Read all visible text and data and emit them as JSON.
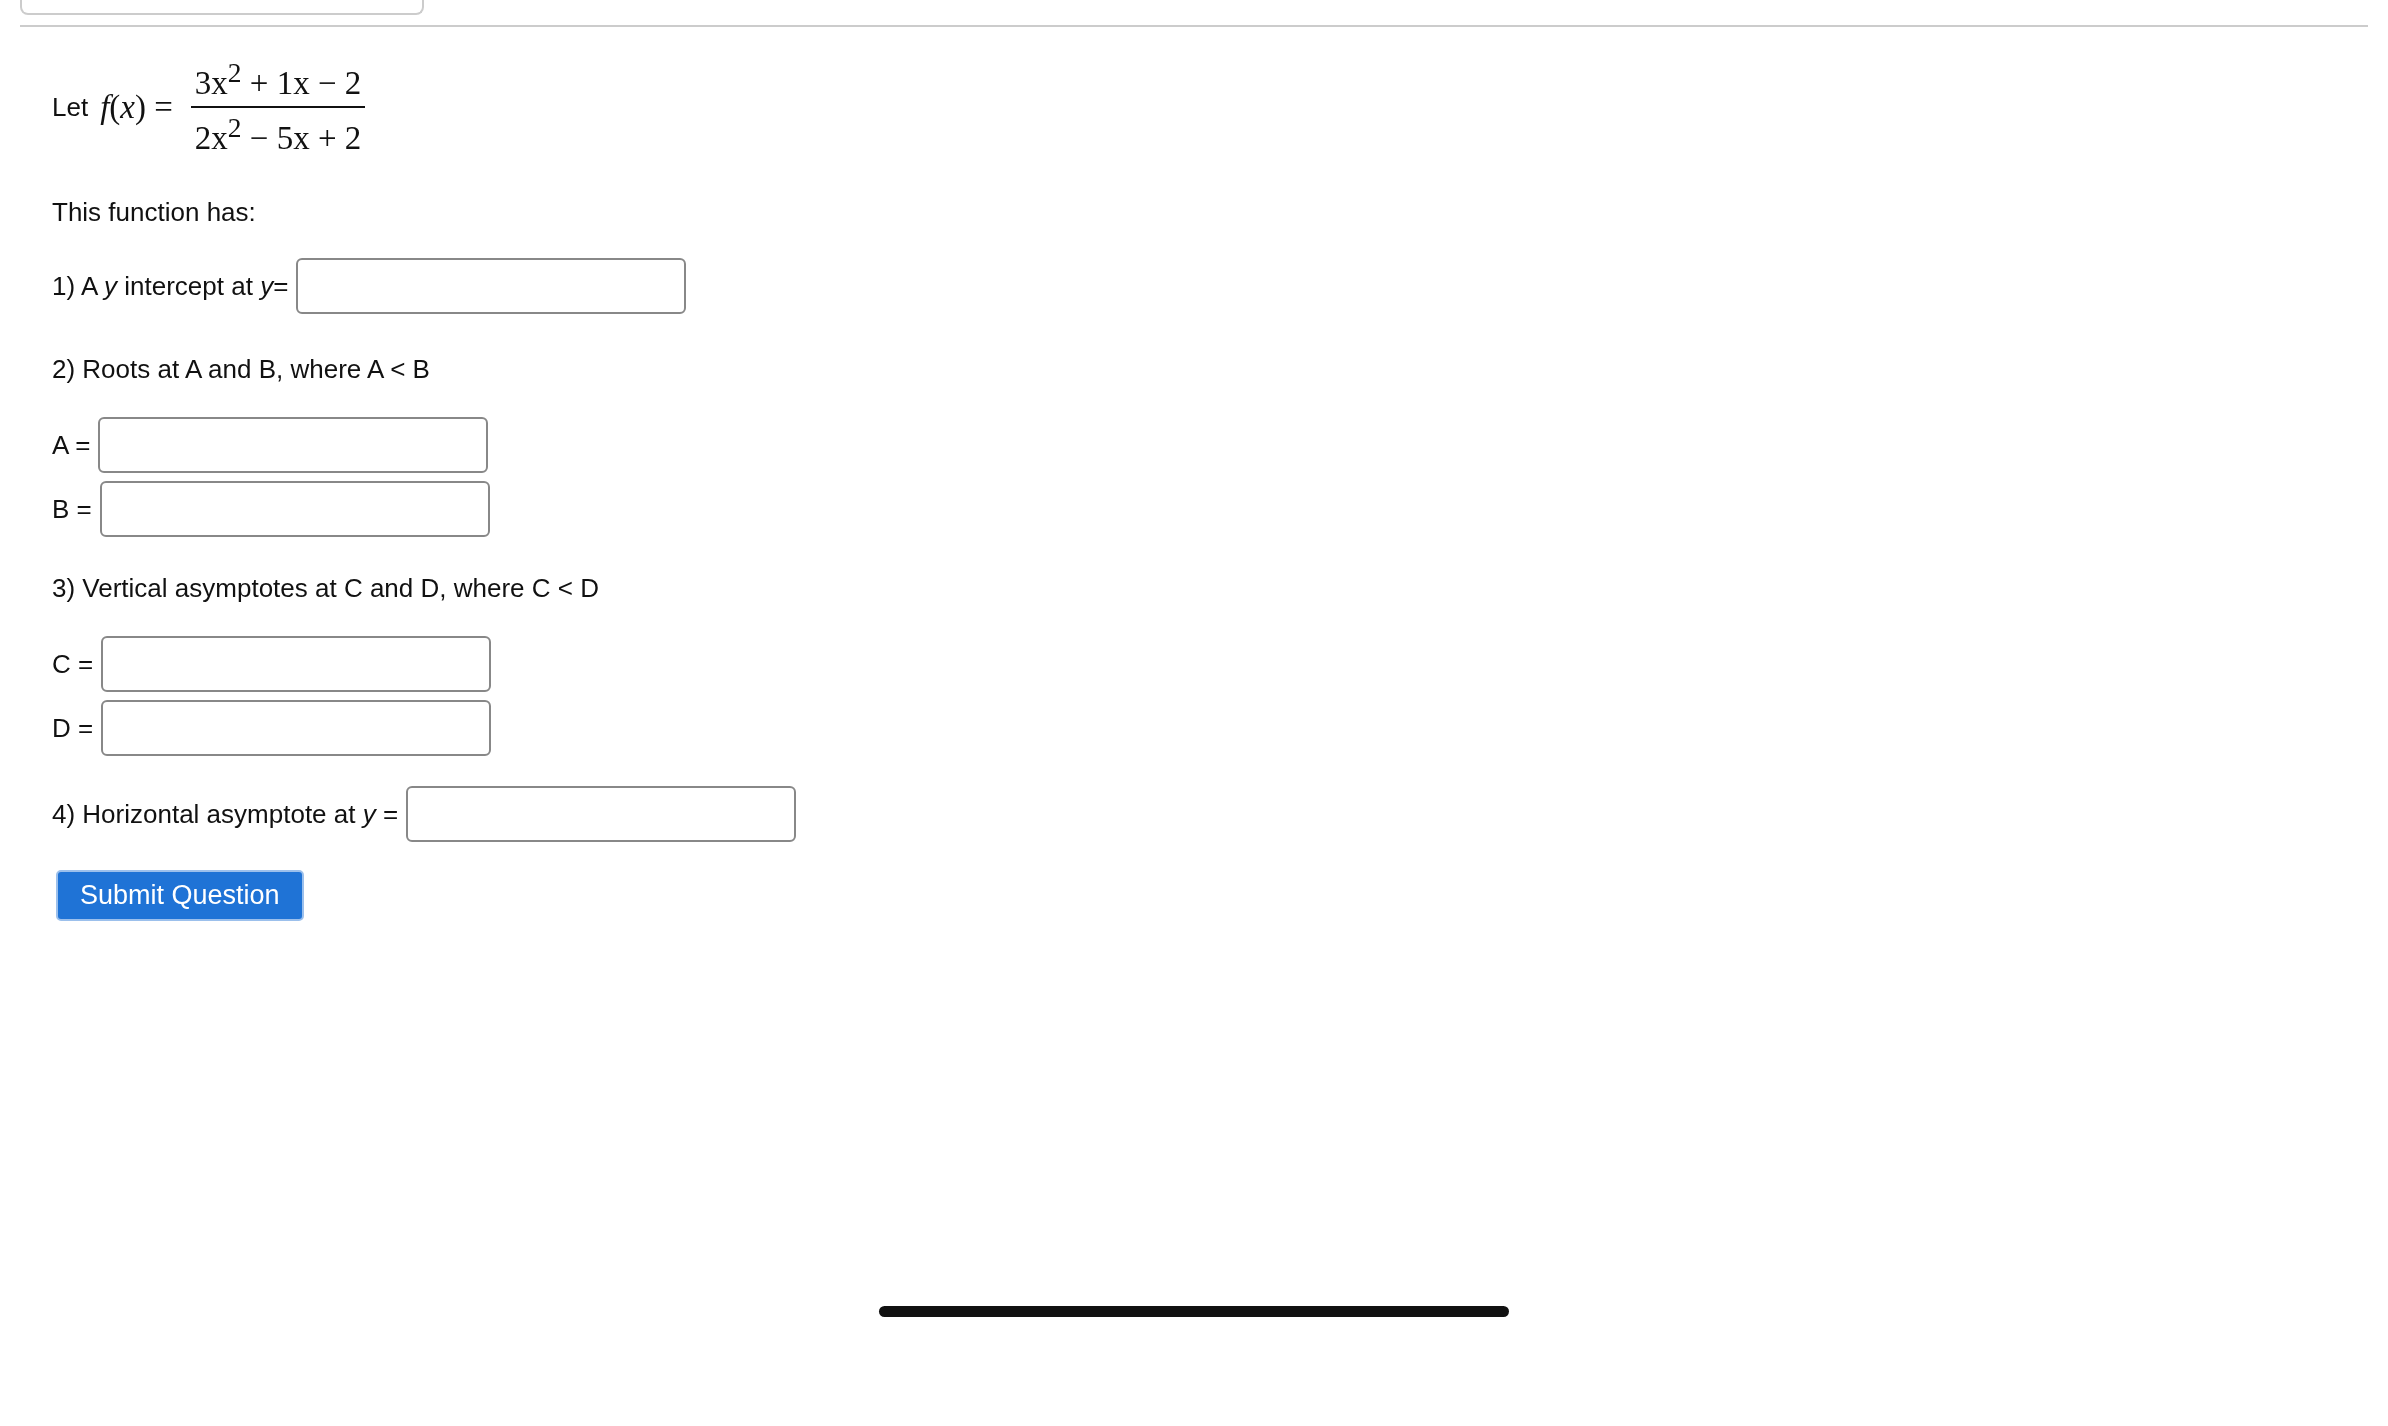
{
  "formula": {
    "prefix": "Let",
    "lhs": "*f*(*x*) =",
    "numerator": "3x$^{2}$ + 1x − 2",
    "denominator": "2x$^{2}$ − 5x + 2"
  },
  "blocks": [
    {
      "kind": "text",
      "text": "This function has:"
    },
    {
      "kind": "inline_field",
      "label": "1) A *y* intercept at *y*="
    },
    {
      "kind": "text",
      "text": "2) Roots at A and B, where A < B"
    },
    {
      "kind": "field",
      "label": "A ="
    },
    {
      "kind": "field",
      "label": "B ="
    },
    {
      "kind": "text",
      "text": "3) Vertical asymptotes at C and D, where C < D"
    },
    {
      "kind": "field",
      "label": "C ="
    },
    {
      "kind": "field",
      "label": "D ="
    },
    {
      "kind": "inline_field",
      "label": "4) Horizontal asymptote at *y* ="
    }
  ],
  "submit": {
    "label": "Submit Question"
  }
}
